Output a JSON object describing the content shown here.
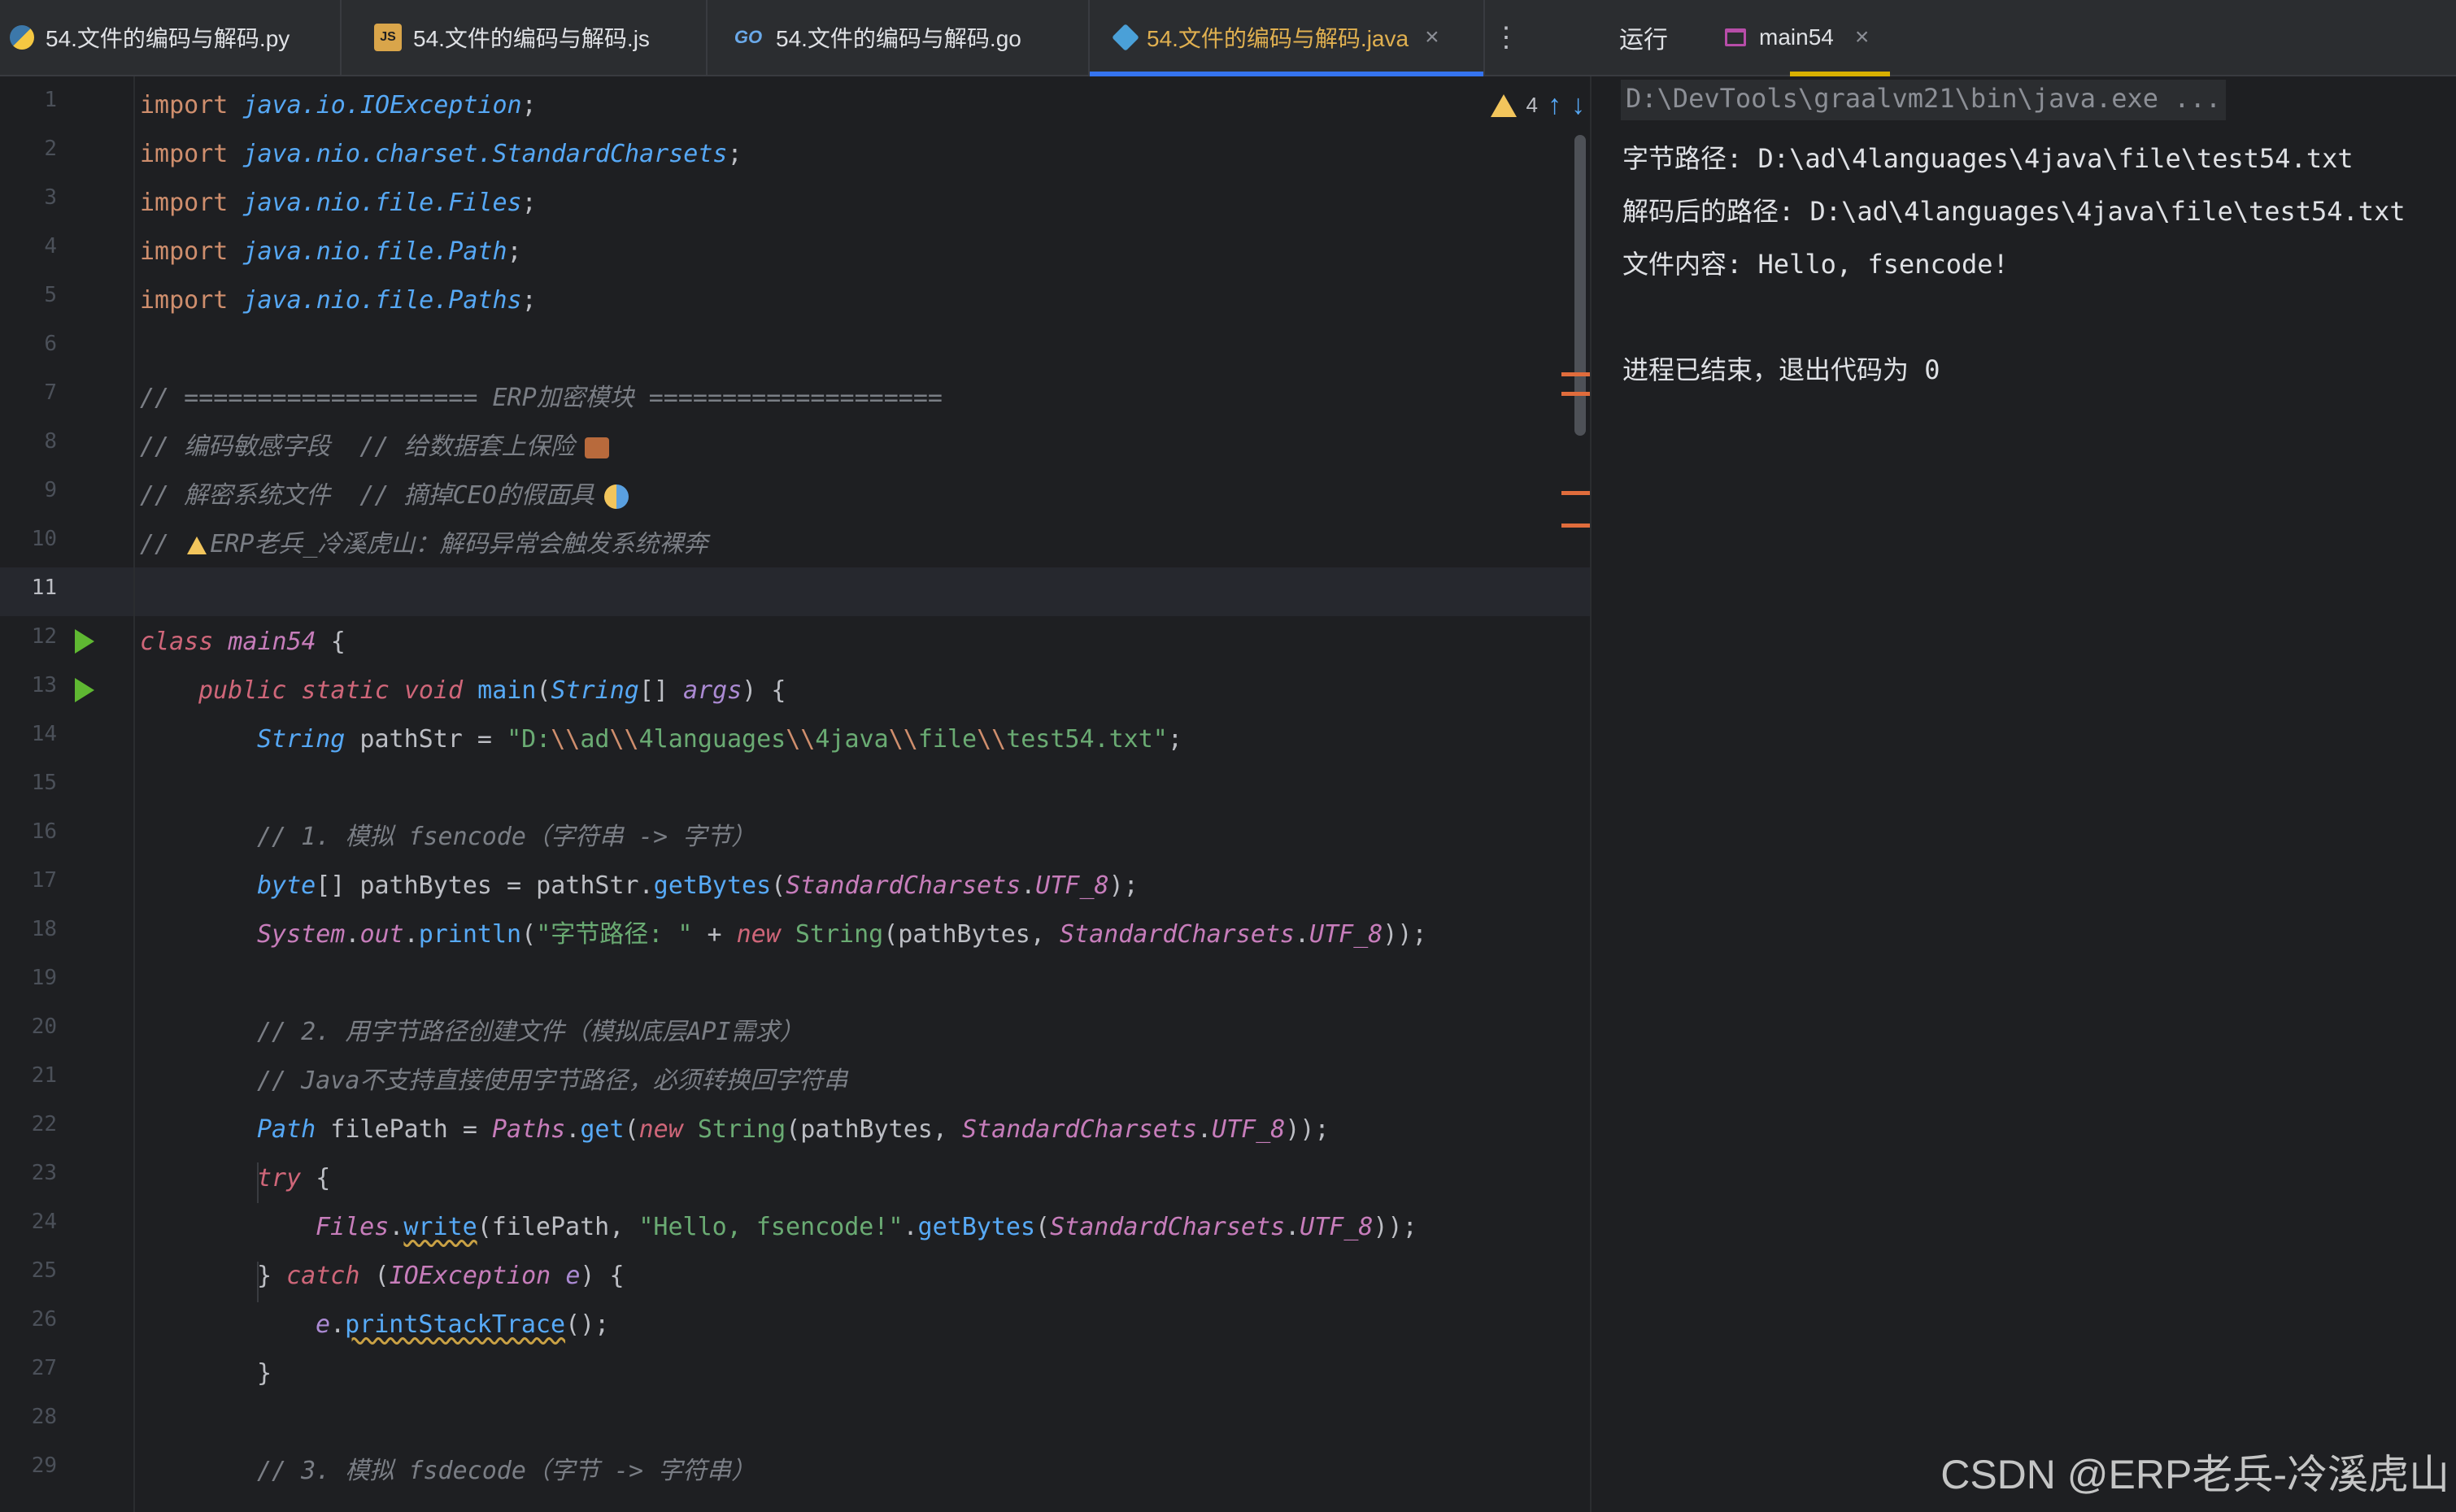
{
  "editor_tabs": [
    {
      "icon": "python-icon",
      "label": "54.文件的编码与解码.py",
      "active": false
    },
    {
      "icon": "javascript-icon",
      "label": "54.文件的编码与解码.js",
      "active": false
    },
    {
      "icon": "go-icon",
      "label": "54.文件的编码与解码.go",
      "active": false
    },
    {
      "icon": "java-icon",
      "label": "54.文件的编码与解码.java",
      "active": true,
      "close": "×"
    }
  ],
  "tabs_more": "⋮",
  "run_panel": {
    "title": "运行",
    "tab_label": "main54",
    "close": "×"
  },
  "inspection": {
    "warning_count": "4",
    "up": "↑",
    "down": "↓"
  },
  "line_numbers": [
    "1",
    "2",
    "3",
    "4",
    "5",
    "6",
    "7",
    "8",
    "9",
    "10",
    "11",
    "12",
    "13",
    "14",
    "15",
    "16",
    "17",
    "18",
    "19",
    "20",
    "21",
    "22",
    "23",
    "24",
    "25",
    "26",
    "27",
    "28",
    "29"
  ],
  "code": {
    "l1": {
      "kw": "import",
      "pkg": "java.io.IOException",
      "end": ";"
    },
    "l2": {
      "kw": "import",
      "pkg": "java.nio.charset.StandardCharsets",
      "end": ";"
    },
    "l3": {
      "kw": "import",
      "pkg": "java.nio.file.Files",
      "end": ";"
    },
    "l4": {
      "kw": "import",
      "pkg": "java.nio.file.Path",
      "end": ";"
    },
    "l5": {
      "kw": "import",
      "pkg": "java.nio.file.Paths",
      "end": ";"
    },
    "l7": "// ==================== ERP加密模块 ====================",
    "l8": "// 编码敏感字段  // 给数据套上保险",
    "l9": "// 解密系统文件  // 摘掉CEO的假面具",
    "l10a": "// ",
    "l10b": "ERP老兵_冷溪虎山：解码异常会触发系统裸奔",
    "l12": {
      "kw": "class",
      "name": "main54",
      "brace": " {"
    },
    "l13": {
      "mod": "public static void",
      "fn": "main",
      "p1": "(",
      "ty": "String",
      "arr": "[] ",
      "arg": "args",
      "end": ") {"
    },
    "l14": {
      "ty": "String",
      "var": " pathStr = ",
      "s1": "\"D:",
      "e1": "\\\\",
      "s2": "ad",
      "e2": "\\\\",
      "s3": "4languages",
      "e3": "\\\\",
      "s4": "4java",
      "e4": "\\\\",
      "s5": "file",
      "e5": "\\\\",
      "s6": "test54.txt\"",
      "end": ";"
    },
    "l16": "// 1. 模拟 fsencode（字符串 -> 字节）",
    "l17": {
      "ty": "byte",
      "a": "[] pathBytes = pathStr.",
      "fn": "getBytes",
      "p": "(",
      "cls": "StandardCharsets",
      "dot": ".",
      "fld": "UTF_8",
      "end": ");"
    },
    "l18": {
      "cls": "System",
      "d1": ".",
      "fld": "out",
      "d2": ".",
      "fn": "println",
      "p": "(",
      "str": "\"字节路径: \"",
      "plus": " + ",
      "kw": "new",
      "sp": " ",
      "ty": "String",
      "a": "(pathBytes, ",
      "cls2": "StandardCharsets",
      "d3": ".",
      "fld2": "UTF_8",
      "end": "));"
    },
    "l20": "// 2. 用字节路径创建文件（模拟底层API需求）",
    "l21": "// Java不支持直接使用字节路径，必须转换回字符串",
    "l22": {
      "ty": "Path",
      "a": " filePath = ",
      "cls": "Paths",
      "d": ".",
      "fn": "get",
      "p": "(",
      "kw": "new",
      "sp": " ",
      "ty2": "String",
      "b": "(pathBytes, ",
      "cls2": "StandardCharsets",
      "d2": ".",
      "fld": "UTF_8",
      "end": "));"
    },
    "l23": {
      "kw": "try",
      "end": " {"
    },
    "l24": {
      "cls": "Files",
      "d": ".",
      "fn": "write",
      "a": "(filePath, ",
      "str": "\"Hello, fsencode!\"",
      "d2": ".",
      "fn2": "getBytes",
      "p": "(",
      "cls2": "StandardCharsets",
      "d3": ".",
      "fld": "UTF_8",
      "end": "));"
    },
    "l25": {
      "a": "} ",
      "kw": "catch",
      "b": " (",
      "cls": "IOException",
      "sp": " ",
      "par": "e",
      "end": ") {"
    },
    "l26": {
      "par": "e",
      "d": ".",
      "fn": "printStackTrace",
      "end": "();"
    },
    "l27": "}",
    "l29": "// 3. 模拟 fsdecode（字节 -> 字符串）"
  },
  "console": {
    "cmd": "D:\\DevTools\\graalvm21\\bin\\java.exe ...",
    "line1": "字节路径: D:\\ad\\4languages\\4java\\file\\test54.txt",
    "line2": "解码后的路径: D:\\ad\\4languages\\4java\\file\\test54.txt",
    "line3": "文件内容: Hello, fsencode!",
    "exit": "进程已结束，退出代码为 0"
  },
  "watermark": "CSDN @ERP老兵-冷溪虎山",
  "colors": {
    "accent": "#3574f0",
    "active_tab_text": "#e0b050",
    "run_icon": "#5fb832",
    "warning": "#f2c55c"
  }
}
